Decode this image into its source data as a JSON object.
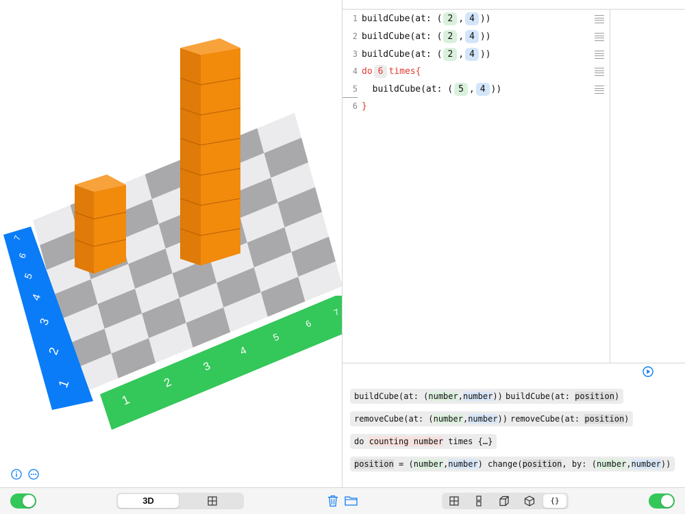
{
  "scene": {
    "y_axis_labels": [
      "7",
      "6",
      "5",
      "4",
      "3",
      "2",
      "1"
    ],
    "x_axis_labels": [
      "1",
      "2",
      "3",
      "4",
      "5",
      "6",
      "7"
    ],
    "colors": {
      "x_axis": "#34c759",
      "y_axis": "#0a7cf7",
      "cube": "#f28a0c",
      "tile_dark": "#a9a9ab",
      "tile_light": "#ebebee"
    }
  },
  "editor": {
    "lines": [
      {
        "num": "1",
        "text_a": "buildCube(at: (",
        "x": "2",
        "y": "4",
        "text_b": "))"
      },
      {
        "num": "2",
        "text_a": "buildCube(at: (",
        "x": "2",
        "y": "4",
        "text_b": "))"
      },
      {
        "num": "3",
        "text_a": "buildCube(at: (",
        "x": "2",
        "y": "4",
        "text_b": "))"
      },
      {
        "num": "4",
        "kw_do": "do",
        "count": "6",
        "kw_times": "times{"
      },
      {
        "num": "5",
        "text_a": "  buildCube(at: (",
        "x": "5",
        "y": "4",
        "text_b": "))"
      },
      {
        "num": "6",
        "close": "}"
      }
    ]
  },
  "palette": {
    "chip1": {
      "a": "buildCube(at: (",
      "b": "number",
      ",": ",",
      "c": "number",
      "d": "))"
    },
    "chip2": {
      "a": "buildCube(at: ",
      "b": "position",
      "c": ")"
    },
    "chip3": {
      "a": "removeCube(at: (",
      "b": "number",
      ",": ",",
      "c": "number",
      "d": "))"
    },
    "chip4": {
      "a": "removeCube(at: ",
      "b": "position",
      "c": ")"
    },
    "chip5": {
      "a": "do ",
      "b": "counting number",
      "c": " times {…}"
    },
    "chip6": {
      "a": "position",
      "b": " = (",
      "c": "number",
      ",": ",",
      "d": "number",
      "e": ")"
    },
    "chip7": {
      "a": "change(",
      "b": "position",
      "c": ", by: (",
      "d": "number",
      ",": ",",
      "e": "number",
      "f": "))"
    }
  },
  "toolbar": {
    "view_3d": "3D",
    "braces": "{}"
  }
}
